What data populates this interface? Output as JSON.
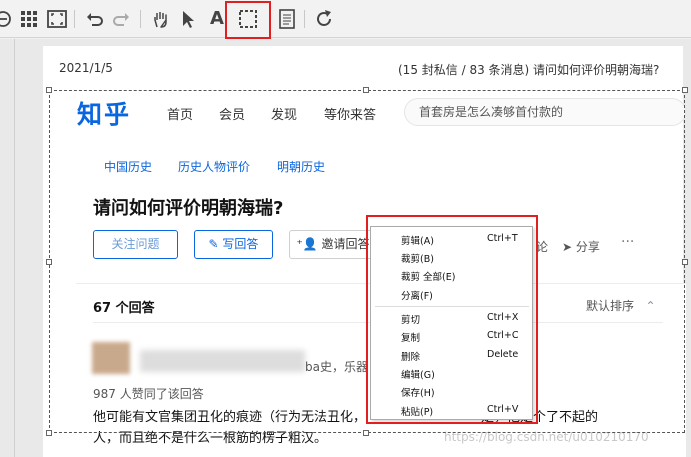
{
  "toolbar": {
    "icons": [
      "zoom-out-icon",
      "grid-icon",
      "fit-screen-icon",
      "undo-icon",
      "redo-icon",
      "hand-tool-icon",
      "pointer-icon",
      "text-tool-icon",
      "selection-tool-icon",
      "notes-icon",
      "refresh-icon"
    ],
    "highlight_color": "#e02020",
    "text_tool_label": "A"
  },
  "page": {
    "date": "2021/1/5",
    "title": "(15 封私信 / 83 条消息) 请问如何评价明朝海瑞?",
    "watermark": "https://blog.csdn.net/u010210170"
  },
  "zhihu": {
    "logo": "知乎",
    "nav": [
      "首页",
      "会员",
      "发现",
      "等你来答"
    ],
    "search_placeholder": "首套房是怎么凑够首付款的",
    "topics": [
      "中国历史",
      "历史人物评价",
      "明朝历史"
    ],
    "question_title": "请问如何评价明朝海瑞?",
    "buttons": {
      "follow": "关注问题",
      "write": "写回答",
      "invite": "邀请回答"
    },
    "comment_fragment": "论",
    "share": "分享",
    "more": "···",
    "answer_count": "67 个回答",
    "sort": "默认排序",
    "answer": {
      "author_tail": "ba史，乐器",
      "likes": "987 人赞同了该回答",
      "line1": "他可能有文官集团丑化的痕迹（行为无法丑化，",
      "line1_tail": "是，他是个了不起的",
      "line2": "人，而且绝不是什么一根筋的楞子粗汉。"
    },
    "accent_color": "#0a66e0"
  },
  "context_menu": {
    "items": [
      {
        "label": "剪辑(A)",
        "shortcut": "Ctrl+T"
      },
      {
        "label": "裁剪(B)",
        "shortcut": ""
      },
      {
        "label": "裁剪 全部(E)",
        "shortcut": ""
      },
      {
        "label": "分离(F)",
        "shortcut": ""
      },
      {
        "label": "剪切",
        "shortcut": "Ctrl+X"
      },
      {
        "label": "复制",
        "shortcut": "Ctrl+C"
      },
      {
        "label": "删除",
        "shortcut": "Delete"
      },
      {
        "label": "编辑(G)",
        "shortcut": ""
      },
      {
        "label": "保存(H)",
        "shortcut": ""
      },
      {
        "label": "粘贴(P)",
        "shortcut": "Ctrl+V"
      }
    ]
  }
}
